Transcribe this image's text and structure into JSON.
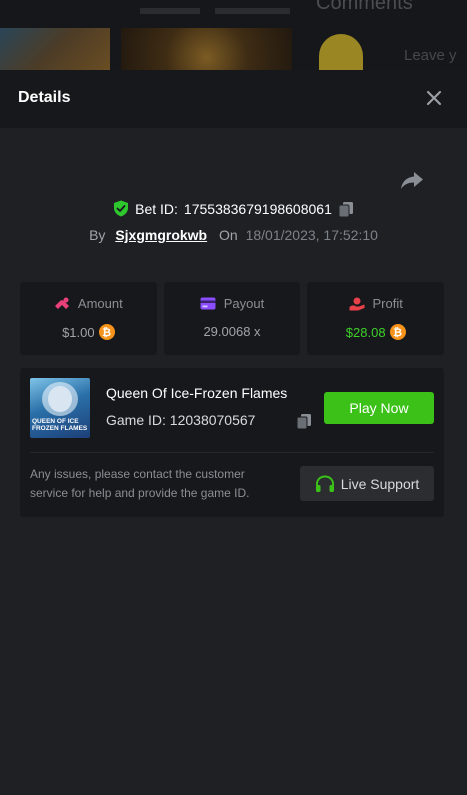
{
  "backdrop": {
    "section_title": "Comments",
    "comment_placeholder": "Leave y"
  },
  "modal": {
    "title": "Details"
  },
  "bet": {
    "id_label": "Bet ID:",
    "id_value": "1755383679198608061",
    "by_label": "By",
    "username": "Sjxgmgrokwb",
    "on_label": "On",
    "datetime": "18/01/2023, 17:52:10"
  },
  "stats": {
    "amount": {
      "label": "Amount",
      "value": "$1.00",
      "color": "#e8417a"
    },
    "payout": {
      "label": "Payout",
      "value": "29.0068 x",
      "color": "#8b4dff"
    },
    "profit": {
      "label": "Profit",
      "value": "$28.08",
      "color": "#e8414a"
    }
  },
  "game": {
    "name": "Queen Of Ice-Frozen Flames",
    "id_label": "Game ID:",
    "id_value": "12038070567",
    "thumb_text": "QUEEN OF ICE FROZEN FLAMES",
    "play_label": "Play Now",
    "help_text": "Any issues, please contact the customer service for help and provide the game ID.",
    "support_label": "Live Support"
  },
  "colors": {
    "accent_green": "#3bc117",
    "profit_green": "#3ed12a",
    "coin_orange": "#f7931a",
    "verified_green": "#2ec72e"
  },
  "icons": [
    "close-icon",
    "share-icon",
    "shield-check-icon",
    "copy-icon",
    "amount-icon",
    "payout-icon",
    "profit-icon",
    "bitcoin-icon",
    "headset-icon"
  ]
}
